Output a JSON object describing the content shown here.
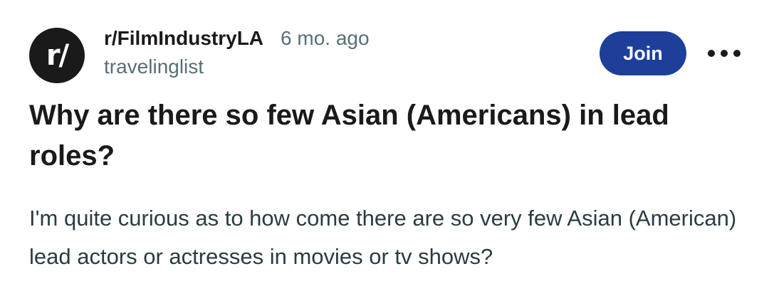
{
  "post": {
    "avatar_text": "r/",
    "subreddit": "r/FilmIndustryLA",
    "time": "6 mo. ago",
    "username": "travelinglist",
    "join_label": "Join",
    "title": "Why are there so few Asian (Americans) in lead roles?",
    "body": "I'm quite curious as to how come there are so very few Asian (American) lead actors or actresses in movies or tv shows?"
  },
  "icons": {
    "more": "more-options-icon"
  },
  "colors": {
    "join_button": "#1d3f99",
    "avatar_bg": "#1a1a1b",
    "meta_text": "#576f76"
  }
}
